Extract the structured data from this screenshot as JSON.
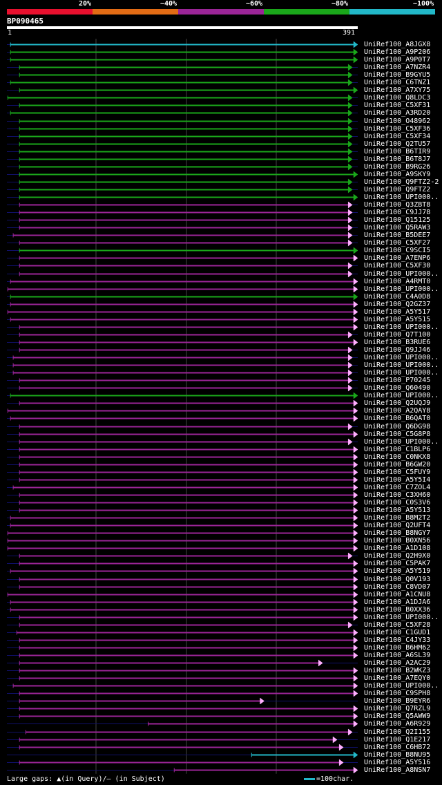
{
  "legend": {
    "segments": [
      {
        "label": "20%",
        "color": "#e8102e"
      },
      {
        "label": "~40%",
        "color": "#e36c15"
      },
      {
        "label": "~60%",
        "color": "#9b2597"
      },
      {
        "label": "~80%",
        "color": "#1aa71a"
      },
      {
        "label": "~100%",
        "color": "#22b8c8"
      }
    ]
  },
  "query": {
    "id": "BP090465",
    "length": 391,
    "start_label": "1",
    "end_label": "391"
  },
  "colors": {
    "purple": "#9b2597",
    "green": "#1aa71a",
    "cyan": "#22b8c8",
    "navy": "#10106a",
    "arrow": "#ffb0ff",
    "grid": "#444444"
  },
  "hits": [
    {
      "name": "UniRef100_A8JGX8",
      "start": 5,
      "end": 391,
      "color": "cyan",
      "arrow": true
    },
    {
      "name": "UniRef100_A9P206",
      "start": 5,
      "end": 391,
      "color": "green",
      "arrow": true
    },
    {
      "name": "UniRef100_A9P0T7",
      "start": 5,
      "end": 391,
      "color": "green",
      "arrow": true
    },
    {
      "name": "UniRef100_A7NZR4",
      "start": 15,
      "end": 385,
      "color": "green",
      "arrow": true
    },
    {
      "name": "UniRef100_B9GYU5",
      "start": 15,
      "end": 385,
      "color": "green",
      "arrow": true
    },
    {
      "name": "UniRef100_C6TNZ1",
      "start": 5,
      "end": 385,
      "color": "green",
      "arrow": true
    },
    {
      "name": "UniRef100_A7XY75",
      "start": 15,
      "end": 391,
      "color": "green",
      "arrow": true
    },
    {
      "name": "UniRef100_Q8LDC3",
      "start": 2,
      "end": 385,
      "color": "green",
      "arrow": true
    },
    {
      "name": "UniRef100_C5XF31",
      "start": 15,
      "end": 385,
      "color": "green",
      "arrow": true
    },
    {
      "name": "UniRef100_A3RD20",
      "start": 5,
      "end": 385,
      "color": "green",
      "arrow": true
    },
    {
      "name": "UniRef100_O48962",
      "start": 15,
      "end": 385,
      "color": "green",
      "arrow": true
    },
    {
      "name": "UniRef100_C5XF36",
      "start": 15,
      "end": 385,
      "color": "green",
      "arrow": true
    },
    {
      "name": "UniRef100_C5XF34",
      "start": 15,
      "end": 385,
      "color": "green",
      "arrow": true
    },
    {
      "name": "UniRef100_Q2TU57",
      "start": 15,
      "end": 385,
      "color": "green",
      "arrow": true
    },
    {
      "name": "UniRef100_B6TIR9",
      "start": 15,
      "end": 385,
      "color": "green",
      "arrow": true
    },
    {
      "name": "UniRef100_B6T8J7",
      "start": 15,
      "end": 385,
      "color": "green",
      "arrow": true
    },
    {
      "name": "UniRef100_B9RG26",
      "start": 15,
      "end": 385,
      "color": "green",
      "arrow": true
    },
    {
      "name": "UniRef100_A9SKY9",
      "start": 15,
      "end": 391,
      "color": "green",
      "arrow": true
    },
    {
      "name": "UniRef100_Q9FTZ2-2",
      "start": 15,
      "end": 385,
      "color": "green",
      "arrow": true
    },
    {
      "name": "UniRef100_Q9FTZ2",
      "start": 15,
      "end": 385,
      "color": "green",
      "arrow": true
    },
    {
      "name": "UniRef100_UPI000..",
      "start": 15,
      "end": 391,
      "color": "green",
      "arrow": true
    },
    {
      "name": "UniRef100_Q3ZBT8",
      "start": 15,
      "end": 385,
      "color": "purple",
      "arrow": true
    },
    {
      "name": "UniRef100_C9JJ78",
      "start": 15,
      "end": 385,
      "color": "purple",
      "arrow": true
    },
    {
      "name": "UniRef100_Q15125",
      "start": 15,
      "end": 385,
      "color": "purple",
      "arrow": true
    },
    {
      "name": "UniRef100_Q5RAW3",
      "start": 15,
      "end": 385,
      "color": "purple",
      "arrow": true
    },
    {
      "name": "UniRef100_B5DEE7",
      "start": 8,
      "end": 385,
      "color": "purple",
      "arrow": true
    },
    {
      "name": "UniRef100_C5XF27",
      "start": 15,
      "end": 385,
      "color": "purple",
      "arrow": true
    },
    {
      "name": "UniRef100_C9SCI5",
      "start": 15,
      "end": 391,
      "color": "green",
      "arrow": true
    },
    {
      "name": "UniRef100_A7ENP6",
      "start": 15,
      "end": 391,
      "color": "purple",
      "arrow": true
    },
    {
      "name": "UniRef100_C5XF30",
      "start": 15,
      "end": 385,
      "color": "purple",
      "arrow": true
    },
    {
      "name": "UniRef100_UPI000..",
      "start": 15,
      "end": 385,
      "color": "purple",
      "arrow": true
    },
    {
      "name": "UniRef100_A4RMT0",
      "start": 5,
      "end": 391,
      "color": "purple",
      "arrow": true
    },
    {
      "name": "UniRef100_UPI000..",
      "start": 2,
      "end": 391,
      "color": "purple",
      "arrow": true
    },
    {
      "name": "UniRef100_C4A0D8",
      "start": 5,
      "end": 391,
      "color": "green",
      "arrow": true
    },
    {
      "name": "UniRef100_Q2GZ37",
      "start": 5,
      "end": 391,
      "color": "purple",
      "arrow": true
    },
    {
      "name": "UniRef100_A5Y517",
      "start": 2,
      "end": 391,
      "color": "purple",
      "arrow": true
    },
    {
      "name": "UniRef100_A5Y515",
      "start": 5,
      "end": 391,
      "color": "purple",
      "arrow": true
    },
    {
      "name": "UniRef100_UPI000..",
      "start": 15,
      "end": 391,
      "color": "purple",
      "arrow": true
    },
    {
      "name": "UniRef100_Q7T100",
      "start": 15,
      "end": 385,
      "color": "purple",
      "arrow": true
    },
    {
      "name": "UniRef100_B3RUE6",
      "start": 15,
      "end": 391,
      "color": "purple",
      "arrow": true
    },
    {
      "name": "UniRef100_Q9JJ46",
      "start": 15,
      "end": 385,
      "color": "purple",
      "arrow": true
    },
    {
      "name": "UniRef100_UPI000..",
      "start": 8,
      "end": 385,
      "color": "purple",
      "arrow": true
    },
    {
      "name": "UniRef100_UPI000..",
      "start": 8,
      "end": 385,
      "color": "purple",
      "arrow": true
    },
    {
      "name": "UniRef100_UPI000..",
      "start": 8,
      "end": 385,
      "color": "purple",
      "arrow": true
    },
    {
      "name": "UniRef100_P70245",
      "start": 15,
      "end": 385,
      "color": "purple",
      "arrow": true
    },
    {
      "name": "UniRef100_Q60490",
      "start": 15,
      "end": 385,
      "color": "purple",
      "arrow": true
    },
    {
      "name": "UniRef100_UPI000..",
      "start": 5,
      "end": 391,
      "color": "green",
      "arrow": true
    },
    {
      "name": "UniRef100_Q2UQJ9",
      "start": 15,
      "end": 391,
      "color": "purple",
      "arrow": true
    },
    {
      "name": "UniRef100_A2QAY8",
      "start": 2,
      "end": 391,
      "color": "purple",
      "arrow": true
    },
    {
      "name": "UniRef100_B6QAT0",
      "start": 5,
      "end": 391,
      "color": "purple",
      "arrow": true
    },
    {
      "name": "UniRef100_Q6DG98",
      "start": 15,
      "end": 385,
      "color": "purple",
      "arrow": true
    },
    {
      "name": "UniRef100_C5G8P8",
      "start": 15,
      "end": 391,
      "color": "purple",
      "arrow": true
    },
    {
      "name": "UniRef100_UPI000..",
      "start": 15,
      "end": 385,
      "color": "purple",
      "arrow": true
    },
    {
      "name": "UniRef100_C1BLP6",
      "start": 15,
      "end": 391,
      "color": "purple",
      "arrow": true
    },
    {
      "name": "UniRef100_C0NKX8",
      "start": 15,
      "end": 391,
      "color": "purple",
      "arrow": true
    },
    {
      "name": "UniRef100_B6GW20",
      "start": 15,
      "end": 391,
      "color": "purple",
      "arrow": true
    },
    {
      "name": "UniRef100_C5FUY9",
      "start": 15,
      "end": 391,
      "color": "purple",
      "arrow": true
    },
    {
      "name": "UniRef100_A5Y5I4",
      "start": 15,
      "end": 391,
      "color": "purple",
      "arrow": true
    },
    {
      "name": "UniRef100_C7ZOL4",
      "start": 8,
      "end": 391,
      "color": "purple",
      "arrow": true
    },
    {
      "name": "UniRef100_C3XH60",
      "start": 15,
      "end": 391,
      "color": "purple",
      "arrow": true
    },
    {
      "name": "UniRef100_C0S3V6",
      "start": 15,
      "end": 391,
      "color": "purple",
      "arrow": true
    },
    {
      "name": "UniRef100_A5Y513",
      "start": 15,
      "end": 391,
      "color": "purple",
      "arrow": true
    },
    {
      "name": "UniRef100_B8M2T2",
      "start": 5,
      "end": 391,
      "color": "purple",
      "arrow": true
    },
    {
      "name": "UniRef100_Q2UFT4",
      "start": 5,
      "end": 391,
      "color": "purple",
      "arrow": true
    },
    {
      "name": "UniRef100_B8NGY7",
      "start": 2,
      "end": 391,
      "color": "purple",
      "arrow": true
    },
    {
      "name": "UniRef100_B0XN56",
      "start": 2,
      "end": 391,
      "color": "purple",
      "arrow": true
    },
    {
      "name": "UniRef100_A1D108",
      "start": 2,
      "end": 391,
      "color": "purple",
      "arrow": true
    },
    {
      "name": "UniRef100_Q2H9X0",
      "start": 15,
      "end": 385,
      "color": "purple",
      "arrow": true
    },
    {
      "name": "UniRef100_C5PAK7",
      "start": 15,
      "end": 391,
      "color": "purple",
      "arrow": true
    },
    {
      "name": "UniRef100_A5Y519",
      "start": 5,
      "end": 391,
      "color": "purple",
      "arrow": true
    },
    {
      "name": "UniRef100_Q0V193",
      "start": 15,
      "end": 391,
      "color": "purple",
      "arrow": true
    },
    {
      "name": "UniRef100_C8VD07",
      "start": 15,
      "end": 391,
      "color": "purple",
      "arrow": true
    },
    {
      "name": "UniRef100_A1CNU8",
      "start": 2,
      "end": 391,
      "color": "purple",
      "arrow": true
    },
    {
      "name": "UniRef100_A1DJA6",
      "start": 5,
      "end": 391,
      "color": "purple",
      "arrow": true
    },
    {
      "name": "UniRef100_B0XX36",
      "start": 5,
      "end": 391,
      "color": "purple",
      "arrow": true
    },
    {
      "name": "UniRef100_UPI000..",
      "start": 15,
      "end": 391,
      "color": "purple",
      "arrow": true
    },
    {
      "name": "UniRef100_C5XF28",
      "start": 15,
      "end": 385,
      "color": "purple",
      "arrow": true
    },
    {
      "name": "UniRef100_C1GUD1",
      "start": 12,
      "end": 391,
      "color": "purple",
      "arrow": true
    },
    {
      "name": "UniRef100_C4JY33",
      "start": 15,
      "end": 391,
      "color": "purple",
      "arrow": true
    },
    {
      "name": "UniRef100_B6HM62",
      "start": 15,
      "end": 391,
      "color": "purple",
      "arrow": true
    },
    {
      "name": "UniRef100_A6SL39",
      "start": 15,
      "end": 391,
      "color": "purple",
      "arrow": true
    },
    {
      "name": "UniRef100_A2AC29",
      "start": 15,
      "end": 352,
      "color": "purple",
      "arrow": true
    },
    {
      "name": "UniRef100_B2WKZ3",
      "start": 15,
      "end": 391,
      "color": "purple",
      "arrow": true
    },
    {
      "name": "UniRef100_A7EQY0",
      "start": 15,
      "end": 391,
      "color": "purple",
      "arrow": true
    },
    {
      "name": "UniRef100_UPI000..",
      "start": 8,
      "end": 391,
      "color": "purple",
      "arrow": true
    },
    {
      "name": "UniRef100_C9SPH8",
      "start": 15,
      "end": 391,
      "color": "purple",
      "arrow": true
    },
    {
      "name": "UniRef100_B9EYR6",
      "start": 15,
      "end": 287,
      "color": "purple",
      "arrow": true
    },
    {
      "name": "UniRef100_Q7RZL9",
      "start": 15,
      "end": 391,
      "color": "purple",
      "arrow": true
    },
    {
      "name": "UniRef100_Q5AWW9",
      "start": 15,
      "end": 391,
      "color": "purple",
      "arrow": true
    },
    {
      "name": "UniRef100_A6R929",
      "start": 158,
      "end": 391,
      "color": "purple",
      "arrow": true
    },
    {
      "name": "UniRef100_Q2I155",
      "start": 22,
      "end": 385,
      "color": "purple",
      "arrow": true
    },
    {
      "name": "UniRef100_Q1E217",
      "start": 15,
      "end": 368,
      "color": "purple",
      "arrow": true
    },
    {
      "name": "UniRef100_C6HB72",
      "start": 15,
      "end": 375,
      "color": "purple",
      "arrow": true
    },
    {
      "name": "UniRef100_B8NU95",
      "start": 273,
      "end": 391,
      "color": "cyan",
      "arrow": true
    },
    {
      "name": "UniRef100_A5Y516",
      "start": 15,
      "end": 375,
      "color": "purple",
      "arrow": true
    },
    {
      "name": "UniRef100_A8NSN7",
      "start": 187,
      "end": 391,
      "color": "purple",
      "arrow": true
    }
  ],
  "footer": {
    "text": "Large gaps: ▲(in Query)/— (in Subject)",
    "scale_label": "=100char."
  }
}
